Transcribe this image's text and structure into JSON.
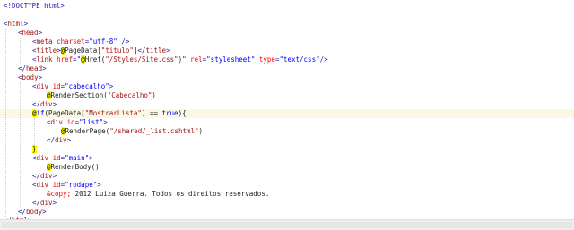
{
  "lines": [
    {
      "indent": 0,
      "tokens": [
        {
          "t": "<!DOCTYPE html>",
          "c": "t-blue"
        }
      ]
    },
    {
      "indent": 0,
      "tokens": []
    },
    {
      "indent": 0,
      "tokens": [
        {
          "t": "<",
          "c": "t-blue"
        },
        {
          "t": "html",
          "c": "t-maroon"
        },
        {
          "t": ">",
          "c": "t-blue"
        }
      ]
    },
    {
      "indent": 1,
      "tokens": [
        {
          "t": "<",
          "c": "t-blue"
        },
        {
          "t": "head",
          "c": "t-maroon"
        },
        {
          "t": ">",
          "c": "t-blue"
        }
      ]
    },
    {
      "indent": 2,
      "tokens": [
        {
          "t": "<",
          "c": "t-blue"
        },
        {
          "t": "meta",
          "c": "t-maroon"
        },
        {
          "t": " ",
          "c": "t-txt"
        },
        {
          "t": "charset",
          "c": "t-red"
        },
        {
          "t": "=",
          "c": "t-blue"
        },
        {
          "t": "\"utf-8\"",
          "c": "t-str"
        },
        {
          "t": " />",
          "c": "t-blue"
        }
      ]
    },
    {
      "indent": 2,
      "tokens": [
        {
          "t": "<",
          "c": "t-blue"
        },
        {
          "t": "title",
          "c": "t-maroon"
        },
        {
          "t": ">",
          "c": "t-blue"
        },
        {
          "t": "@",
          "c": "razor"
        },
        {
          "t": "PageData[",
          "c": "t-txt"
        },
        {
          "t": "\"titulo\"",
          "c": "t-maroon"
        },
        {
          "t": "]",
          "c": "t-txt"
        },
        {
          "t": "</",
          "c": "t-blue"
        },
        {
          "t": "title",
          "c": "t-maroon"
        },
        {
          "t": ">",
          "c": "t-blue"
        }
      ]
    },
    {
      "indent": 2,
      "tokens": [
        {
          "t": "<",
          "c": "t-blue"
        },
        {
          "t": "link",
          "c": "t-maroon"
        },
        {
          "t": " ",
          "c": "t-txt"
        },
        {
          "t": "href",
          "c": "t-red"
        },
        {
          "t": "=",
          "c": "t-blue"
        },
        {
          "t": "\"",
          "c": "t-str"
        },
        {
          "t": "@",
          "c": "razor"
        },
        {
          "t": "Href(",
          "c": "t-txt"
        },
        {
          "t": "\"/Styles/Site.css\"",
          "c": "t-maroon"
        },
        {
          "t": ")",
          "c": "t-txt"
        },
        {
          "t": "\"",
          "c": "t-str"
        },
        {
          "t": " ",
          "c": "t-txt"
        },
        {
          "t": "rel",
          "c": "t-red"
        },
        {
          "t": "=",
          "c": "t-blue"
        },
        {
          "t": "\"stylesheet\"",
          "c": "t-str"
        },
        {
          "t": " ",
          "c": "t-txt"
        },
        {
          "t": "type",
          "c": "t-red"
        },
        {
          "t": "=",
          "c": "t-blue"
        },
        {
          "t": "\"text/css\"",
          "c": "t-str"
        },
        {
          "t": "/>",
          "c": "t-blue"
        }
      ]
    },
    {
      "indent": 1,
      "tokens": [
        {
          "t": "</",
          "c": "t-blue"
        },
        {
          "t": "head",
          "c": "t-maroon"
        },
        {
          "t": ">",
          "c": "t-blue"
        }
      ]
    },
    {
      "indent": 1,
      "tokens": [
        {
          "t": "<",
          "c": "t-blue"
        },
        {
          "t": "body",
          "c": "t-maroon"
        },
        {
          "t": ">",
          "c": "t-blue"
        }
      ]
    },
    {
      "indent": 2,
      "tokens": [
        {
          "t": "<",
          "c": "t-blue"
        },
        {
          "t": "div",
          "c": "t-maroon"
        },
        {
          "t": " ",
          "c": "t-txt"
        },
        {
          "t": "id",
          "c": "t-red"
        },
        {
          "t": "=",
          "c": "t-blue"
        },
        {
          "t": "\"cabecalho\"",
          "c": "t-str"
        },
        {
          "t": ">",
          "c": "t-blue"
        }
      ]
    },
    {
      "indent": 3,
      "tokens": [
        {
          "t": "@",
          "c": "razor"
        },
        {
          "t": "RenderSection(",
          "c": "t-txt"
        },
        {
          "t": "\"Cabecalho\"",
          "c": "t-maroon"
        },
        {
          "t": ")",
          "c": "t-txt"
        }
      ]
    },
    {
      "indent": 2,
      "tokens": [
        {
          "t": "</",
          "c": "t-blue"
        },
        {
          "t": "div",
          "c": "t-maroon"
        },
        {
          "t": ">",
          "c": "t-blue"
        }
      ]
    },
    {
      "indent": 2,
      "hl": true,
      "tokens": [
        {
          "t": "@",
          "c": "razor"
        },
        {
          "t": "if",
          "c": "t-kw"
        },
        {
          "t": "(PageData[",
          "c": "t-txt"
        },
        {
          "t": "\"MostrarLista\"",
          "c": "t-maroon"
        },
        {
          "t": "] == ",
          "c": "t-txt"
        },
        {
          "t": "true",
          "c": "t-kw"
        },
        {
          "t": "){",
          "c": "t-txt"
        }
      ]
    },
    {
      "indent": 3,
      "tokens": [
        {
          "t": "<",
          "c": "t-blue"
        },
        {
          "t": "div",
          "c": "t-maroon"
        },
        {
          "t": " ",
          "c": "t-txt"
        },
        {
          "t": "id",
          "c": "t-red"
        },
        {
          "t": "=",
          "c": "t-blue"
        },
        {
          "t": "\"list\"",
          "c": "t-str"
        },
        {
          "t": ">",
          "c": "t-blue"
        }
      ]
    },
    {
      "indent": 4,
      "tokens": [
        {
          "t": "@",
          "c": "razor"
        },
        {
          "t": "RenderPage(",
          "c": "t-txt"
        },
        {
          "t": "\"/shared/_list.cshtml\"",
          "c": "t-maroon"
        },
        {
          "t": ")",
          "c": "t-txt"
        }
      ]
    },
    {
      "indent": 3,
      "tokens": [
        {
          "t": "</",
          "c": "t-blue"
        },
        {
          "t": "div",
          "c": "t-maroon"
        },
        {
          "t": ">",
          "c": "t-blue"
        }
      ]
    },
    {
      "indent": 2,
      "tokens": [
        {
          "t": "}",
          "c": "razor"
        }
      ]
    },
    {
      "indent": 2,
      "tokens": [
        {
          "t": "<",
          "c": "t-blue"
        },
        {
          "t": "div",
          "c": "t-maroon"
        },
        {
          "t": " ",
          "c": "t-txt"
        },
        {
          "t": "id",
          "c": "t-red"
        },
        {
          "t": "=",
          "c": "t-blue"
        },
        {
          "t": "\"main\"",
          "c": "t-str"
        },
        {
          "t": ">",
          "c": "t-blue"
        }
      ]
    },
    {
      "indent": 3,
      "tokens": [
        {
          "t": "@",
          "c": "razor"
        },
        {
          "t": "RenderBody()",
          "c": "t-txt"
        }
      ]
    },
    {
      "indent": 2,
      "tokens": [
        {
          "t": "</",
          "c": "t-blue"
        },
        {
          "t": "div",
          "c": "t-maroon"
        },
        {
          "t": ">",
          "c": "t-blue"
        }
      ]
    },
    {
      "indent": 2,
      "tokens": [
        {
          "t": "<",
          "c": "t-blue"
        },
        {
          "t": "div",
          "c": "t-maroon"
        },
        {
          "t": " ",
          "c": "t-txt"
        },
        {
          "t": "id",
          "c": "t-red"
        },
        {
          "t": "=",
          "c": "t-blue"
        },
        {
          "t": "\"rodape\"",
          "c": "t-str"
        },
        {
          "t": ">",
          "c": "t-blue"
        }
      ]
    },
    {
      "indent": 3,
      "tokens": [
        {
          "t": "&copy;",
          "c": "t-red"
        },
        {
          "t": " 2012 Luiza Guerra. Todos os direitos reservados.",
          "c": "t-txt"
        }
      ]
    },
    {
      "indent": 2,
      "tokens": [
        {
          "t": "</",
          "c": "t-blue"
        },
        {
          "t": "div",
          "c": "t-maroon"
        },
        {
          "t": ">",
          "c": "t-blue"
        }
      ]
    },
    {
      "indent": 1,
      "tokens": [
        {
          "t": "</",
          "c": "t-blue"
        },
        {
          "t": "body",
          "c": "t-maroon"
        },
        {
          "t": ">",
          "c": "t-blue"
        }
      ]
    },
    {
      "indent": 0,
      "tokens": [
        {
          "t": "</",
          "c": "t-blue"
        },
        {
          "t": "html",
          "c": "t-maroon"
        },
        {
          "t": ">",
          "c": "t-blue"
        }
      ]
    }
  ]
}
